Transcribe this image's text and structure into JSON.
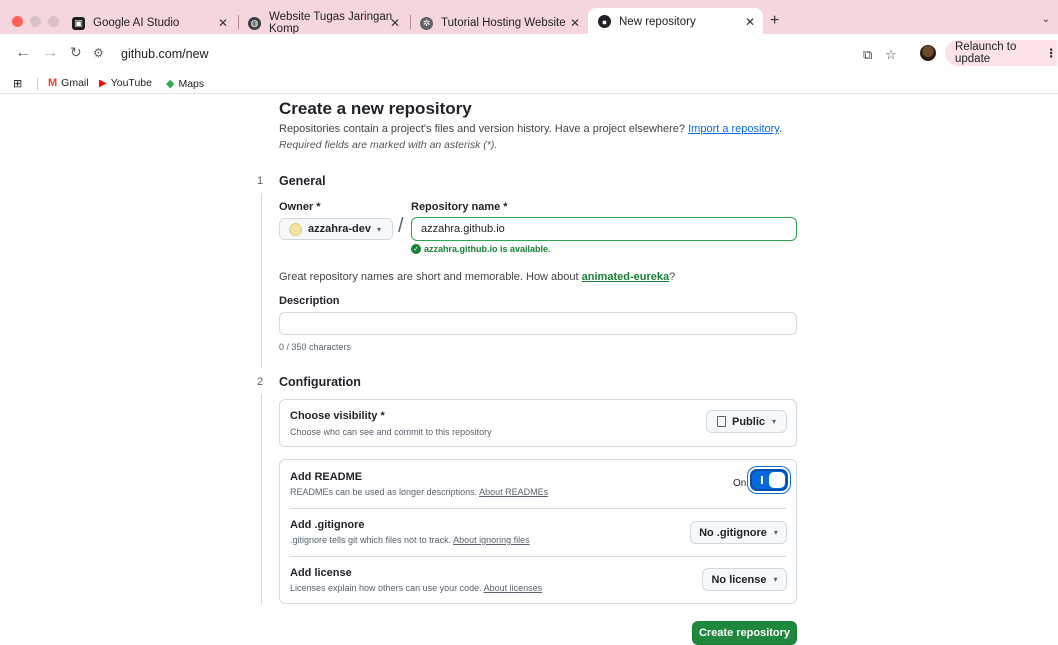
{
  "browser": {
    "tabs": [
      {
        "title": "Google AI Studio",
        "icon": "ai-studio-icon"
      },
      {
        "title": "Website Tugas Jaringan Komp",
        "icon": "globe-icon"
      },
      {
        "title": "Tutorial Hosting Website",
        "icon": "hosting-icon"
      },
      {
        "title": "New repository",
        "icon": "github-icon",
        "active": true
      }
    ],
    "url": "github.com/new",
    "relaunch_label": "Relaunch to update",
    "bookmarks": [
      {
        "label": "Gmail",
        "icon": "gmail-icon"
      },
      {
        "label": "YouTube",
        "icon": "youtube-icon"
      },
      {
        "label": "Maps",
        "icon": "maps-icon"
      }
    ]
  },
  "page": {
    "title": "Create a new repository",
    "subtitle_prefix": "Repositories contain a project's files and version history. Have a project elsewhere?",
    "import_link": "Import a repository",
    "subtitle_suffix": ".",
    "required_note": "Required fields are marked with an asterisk (*).",
    "step1": {
      "number": "1",
      "title": "General"
    },
    "owner_label": "Owner *",
    "owner_value": "azzahra-dev",
    "slash": "/",
    "repo_label": "Repository name *",
    "repo_value": "azzahra.github.io",
    "availability": "azzahra.github.io is available.",
    "hint_prefix": "Great repository names are short and memorable. How about",
    "hint_suggestion": "animated-eureka",
    "hint_suffix": "?",
    "description_label": "Description",
    "description_value": "",
    "char_count": "0 / 350 characters",
    "step2": {
      "number": "2",
      "title": "Configuration"
    },
    "visibility": {
      "title": "Choose visibility *",
      "desc": "Choose who can see and commit to this repository",
      "value": "Public"
    },
    "readme": {
      "title": "Add README",
      "desc": "READMEs can be used as longer descriptions.",
      "link": "About READMEs",
      "toggle_label": "On"
    },
    "gitignore": {
      "title": "Add .gitignore",
      "desc": ".gitignore tells git which files not to track.",
      "link": "About ignoring files",
      "value": "No .gitignore"
    },
    "license": {
      "title": "Add license",
      "desc": "Licenses explain how others can use your code.",
      "link": "About licenses",
      "value": "No license"
    },
    "create_button": "Create repository"
  },
  "colors": {
    "accent_green": "#1f883d",
    "toggle_blue": "#0969da",
    "tab_strip": "#f6d6dd"
  }
}
